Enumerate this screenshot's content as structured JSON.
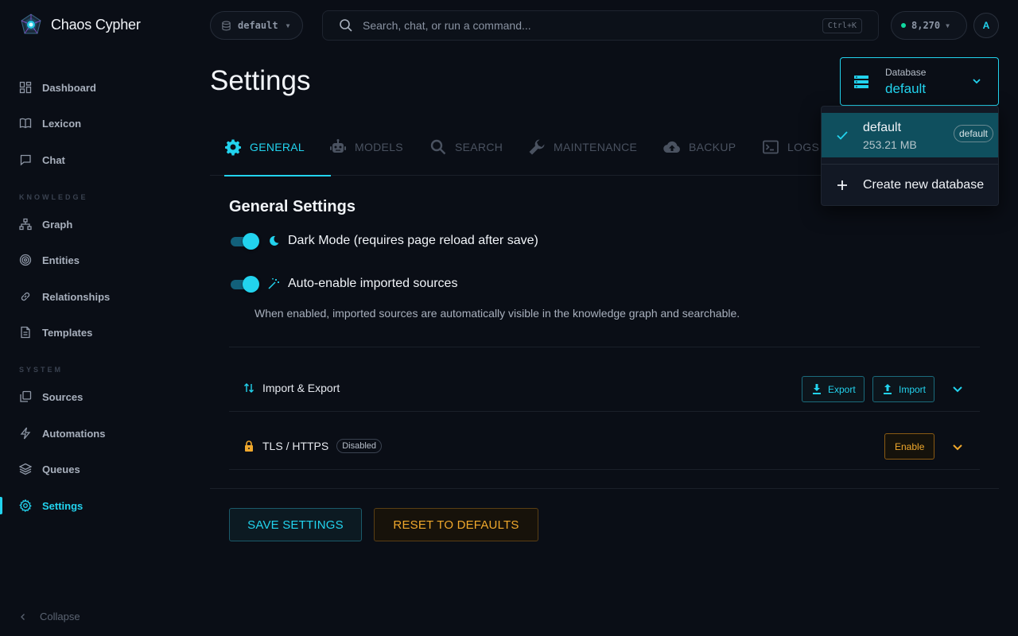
{
  "app": {
    "name": "Chaos Cypher"
  },
  "topbar": {
    "db_pill_label": "default",
    "search_placeholder": "Search, chat, or run a command...",
    "search_shortcut": "Ctrl+K",
    "credits": "8,270",
    "avatar_initial": "A"
  },
  "sidebar": {
    "main_items": [
      {
        "label": "Dashboard",
        "icon": "dashboard-icon"
      },
      {
        "label": "Lexicon",
        "icon": "book-icon"
      },
      {
        "label": "Chat",
        "icon": "chat-icon"
      }
    ],
    "knowledge_label": "KNOWLEDGE",
    "knowledge_items": [
      {
        "label": "Graph",
        "icon": "graph-icon"
      },
      {
        "label": "Entities",
        "icon": "target-icon"
      },
      {
        "label": "Relationships",
        "icon": "link-icon"
      },
      {
        "label": "Templates",
        "icon": "document-icon"
      }
    ],
    "system_label": "SYSTEM",
    "system_items": [
      {
        "label": "Sources",
        "icon": "sources-icon"
      },
      {
        "label": "Automations",
        "icon": "lightning-icon"
      },
      {
        "label": "Queues",
        "icon": "layers-icon"
      },
      {
        "label": "Settings",
        "icon": "gear-icon",
        "active": true
      }
    ],
    "collapse_label": "Collapse"
  },
  "page": {
    "title": "Settings",
    "database_select": {
      "label": "Database",
      "value": "default"
    }
  },
  "tabs": [
    {
      "label": "GENERAL",
      "icon": "gear-icon",
      "active": true
    },
    {
      "label": "MODELS",
      "icon": "robot-icon"
    },
    {
      "label": "SEARCH",
      "icon": "search-icon"
    },
    {
      "label": "MAINTENANCE",
      "icon": "wrench-icon"
    },
    {
      "label": "BACKUP",
      "icon": "cloud-upload-icon"
    },
    {
      "label": "LOGS",
      "icon": "terminal-icon"
    }
  ],
  "general": {
    "section_title": "General Settings",
    "dark_mode": {
      "label": "Dark Mode (requires page reload after save)",
      "enabled": true
    },
    "auto_enable": {
      "label": "Auto-enable imported sources",
      "enabled": true
    },
    "auto_enable_help": "When enabled, imported sources are automatically visible in the knowledge graph and searchable.",
    "import_export": {
      "label": "Import & Export",
      "export_label": "Export",
      "import_label": "Import"
    },
    "tls": {
      "label": "TLS / HTTPS",
      "badge": "Disabled",
      "enable_label": "Enable"
    }
  },
  "actions": {
    "save_label": "SAVE SETTINGS",
    "reset_label": "RESET TO DEFAULTS"
  },
  "db_menu": {
    "selected": {
      "name": "default",
      "size": "253.21 MB",
      "tag": "default"
    },
    "create_label": "Create new database"
  },
  "colors": {
    "accent": "#22d3ee",
    "warning": "#f0a82c",
    "background": "#0a0e16",
    "credit_dot": "#10d9a0"
  }
}
